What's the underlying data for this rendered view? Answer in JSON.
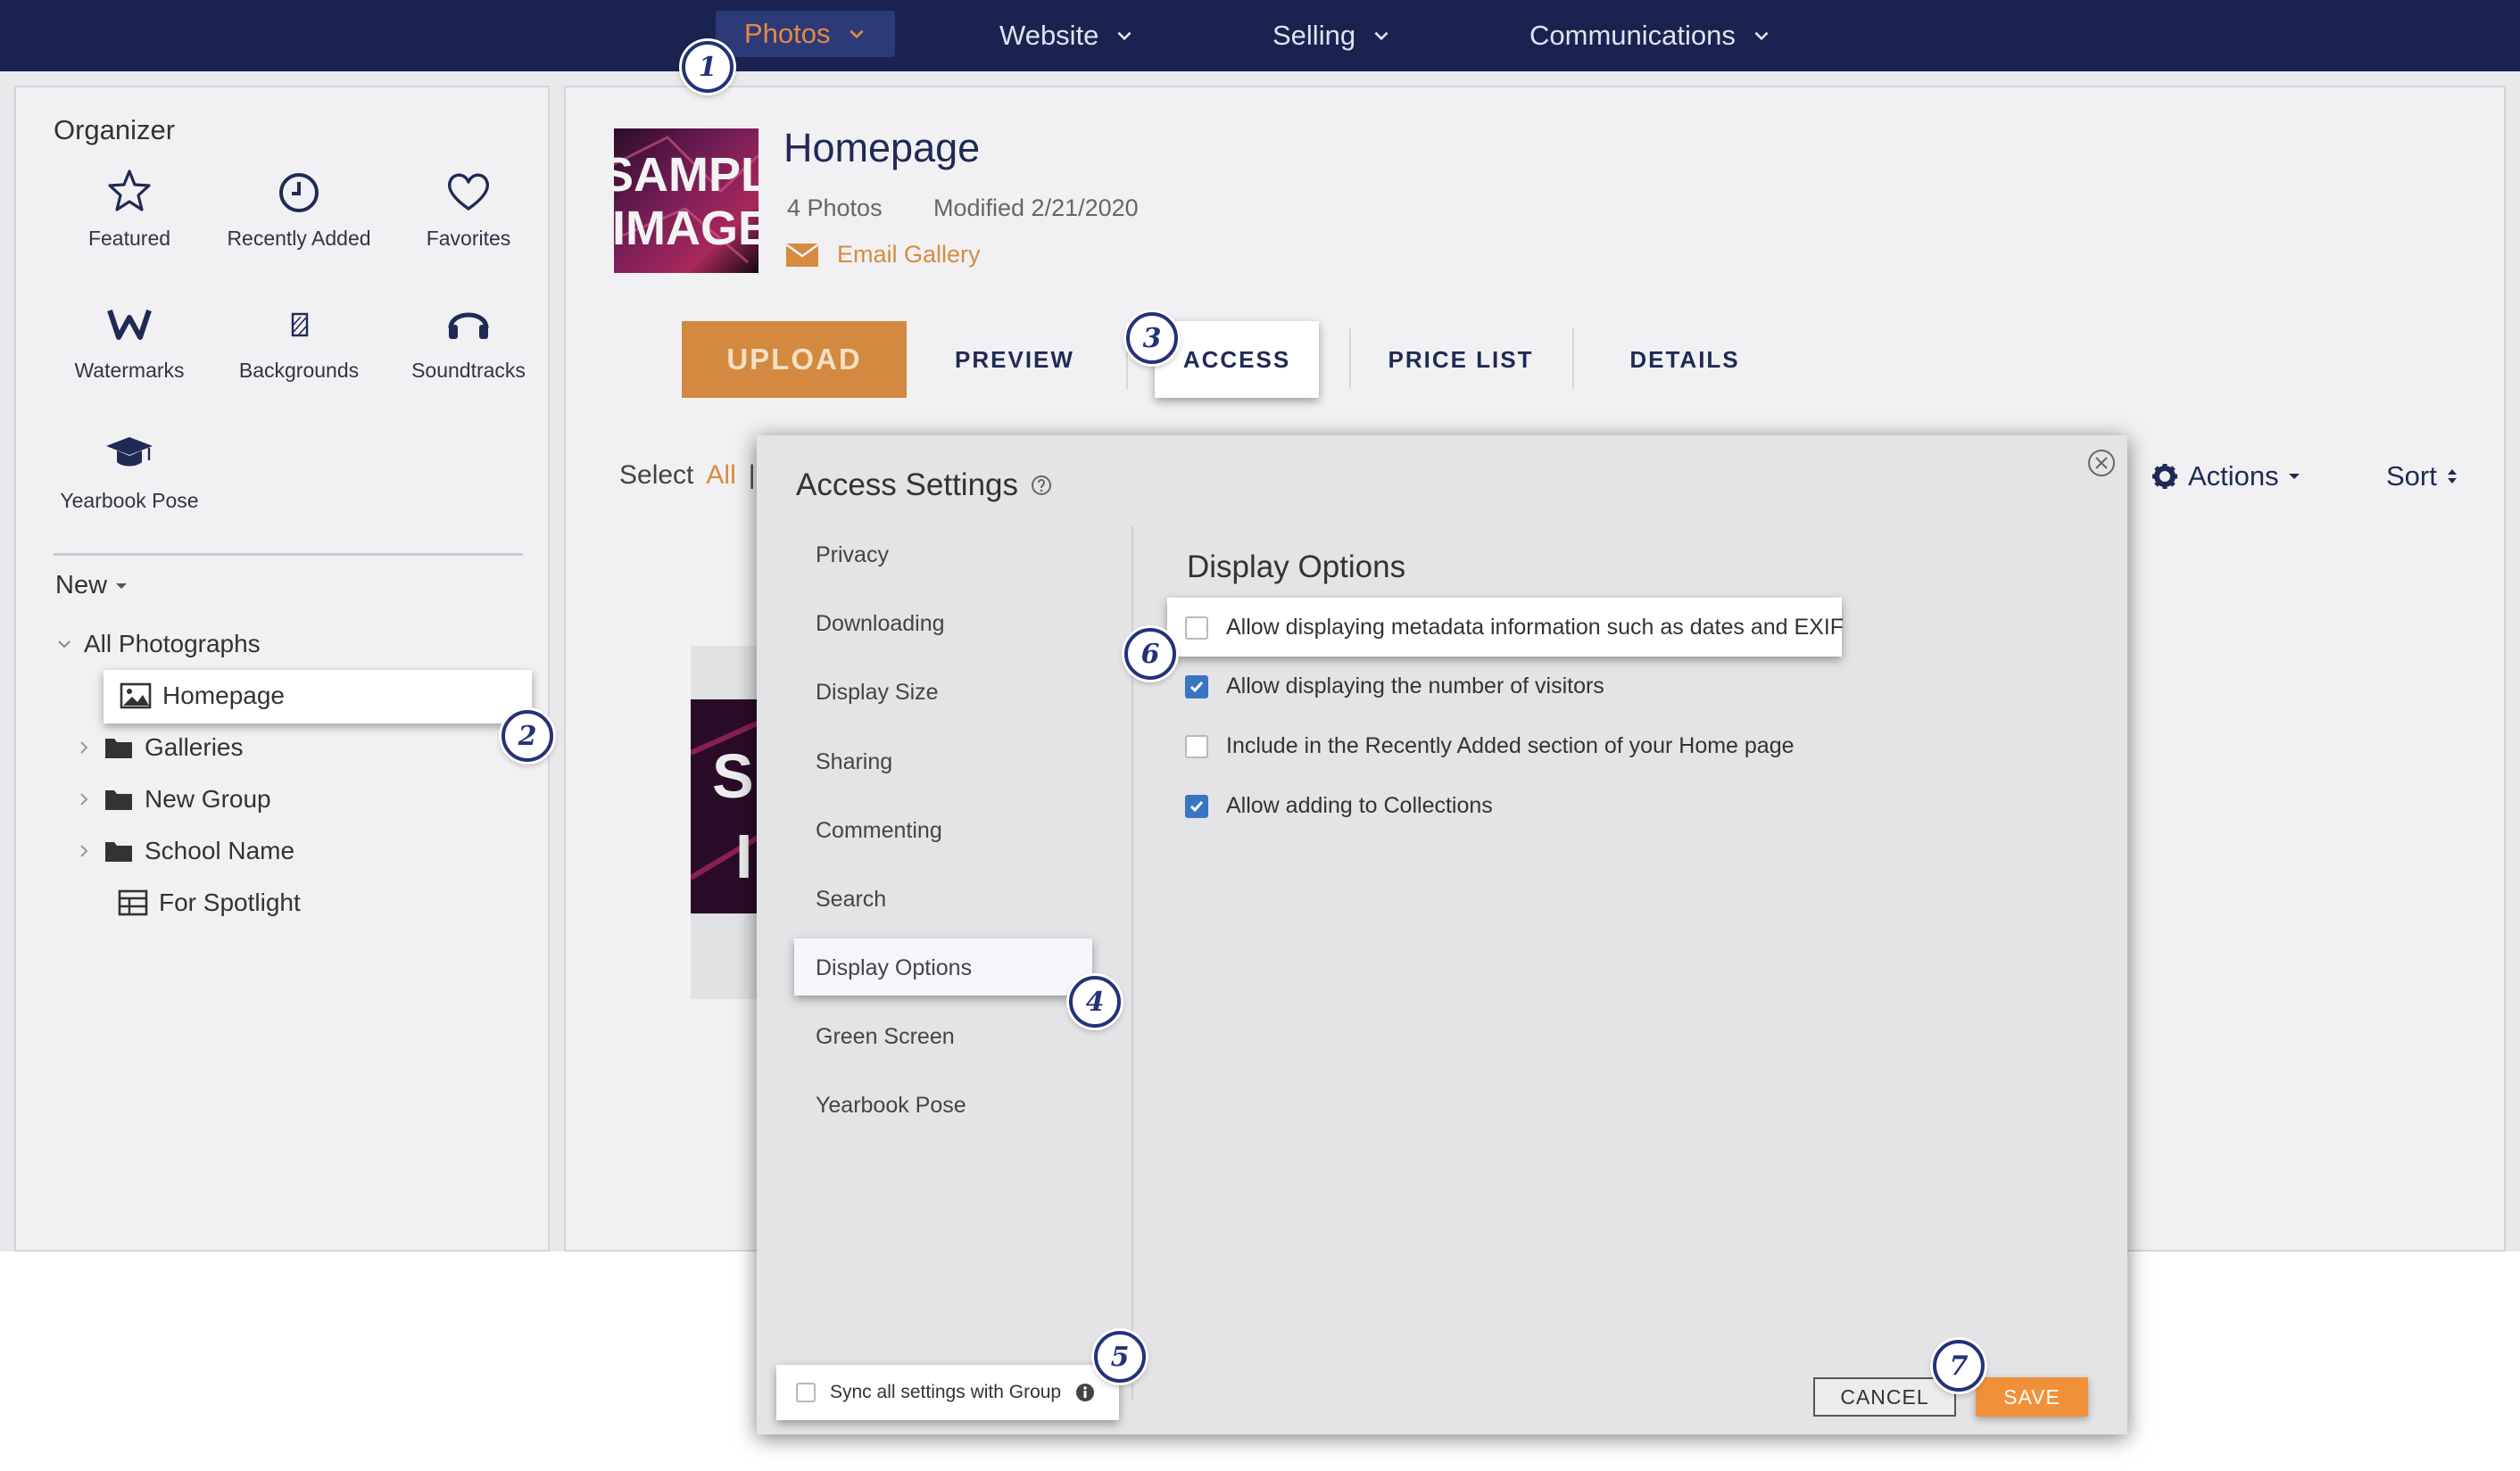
{
  "topnav": {
    "items": [
      {
        "label": "Photos",
        "active": true
      },
      {
        "label": "Website"
      },
      {
        "label": "Selling"
      },
      {
        "label": "Communications"
      }
    ]
  },
  "sidebar": {
    "title": "Organizer",
    "tools": [
      {
        "label": "Featured",
        "icon": "star-icon"
      },
      {
        "label": "Recently Added",
        "icon": "clock-icon"
      },
      {
        "label": "Favorites",
        "icon": "heart-icon"
      },
      {
        "label": "Watermarks",
        "icon": "watermark-icon"
      },
      {
        "label": "Backgrounds",
        "icon": "backgrounds-icon"
      },
      {
        "label": "Soundtracks",
        "icon": "headphones-icon"
      },
      {
        "label": "Yearbook Pose",
        "icon": "graduation-cap-icon"
      }
    ],
    "new_label": "New",
    "tree": {
      "root": "All Photographs",
      "items": [
        "Homepage",
        "Galleries",
        "New Group",
        "School Name",
        "For Spotlight"
      ]
    }
  },
  "gallery": {
    "title": "Homepage",
    "photo_count": "4 Photos",
    "modified": "Modified 2/21/2020",
    "email_label": "Email Gallery",
    "thumb_text": [
      "SAMPL",
      "IMAGE"
    ],
    "bg_thumb_text": [
      "S",
      "I"
    ]
  },
  "tabs": [
    "UPLOAD",
    "PREVIEW",
    "ACCESS",
    "PRICE LIST",
    "DETAILS"
  ],
  "toolbar": {
    "select_label": "Select",
    "select_all": "All",
    "select_sep": "|",
    "actions_label": "Actions",
    "sort_label": "Sort"
  },
  "modal": {
    "title": "Access Settings",
    "menu": [
      "Privacy",
      "Downloading",
      "Display Size",
      "Sharing",
      "Commenting",
      "Search",
      "Display Options",
      "Green Screen",
      "Yearbook Pose"
    ],
    "section_title": "Display Options",
    "options": [
      {
        "label": "Allow displaying metadata information such as dates and EXIF",
        "checked": false
      },
      {
        "label": "Allow displaying the number of visitors",
        "checked": true
      },
      {
        "label": "Include in the Recently Added section of your Home page",
        "checked": false
      },
      {
        "label": "Allow adding to Collections",
        "checked": true
      }
    ],
    "sync_label": "Sync all settings with Group",
    "cancel_label": "CANCEL",
    "save_label": "SAVE"
  },
  "badges": [
    "1",
    "2",
    "3",
    "4",
    "5",
    "6",
    "7"
  ],
  "colors": {
    "nav_bg": "#1a2350",
    "accent_orange": "#d3893f",
    "checkbox_blue": "#3a75c4",
    "badge_navy": "#243377"
  }
}
